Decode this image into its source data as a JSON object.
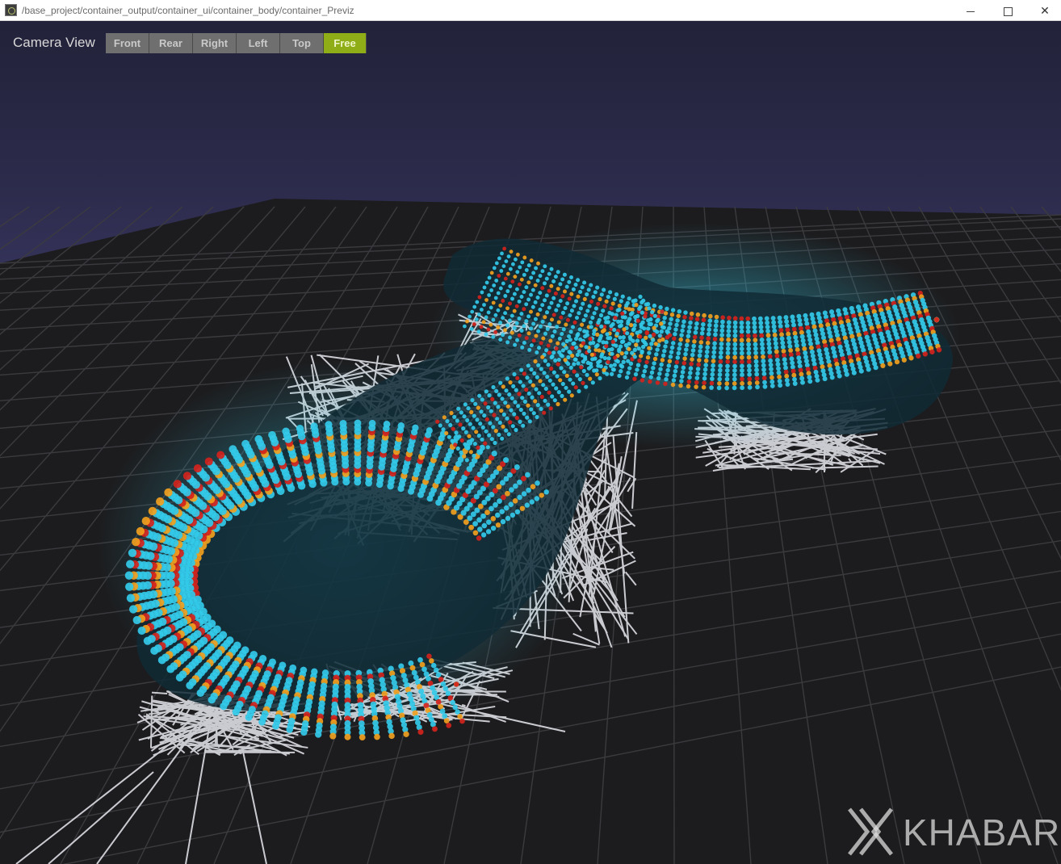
{
  "window": {
    "title": "/base_project/container_output/container_ui/container_body/container_Previz"
  },
  "viewport": {
    "camera_label": "Camera View",
    "camera_views": [
      {
        "label": "Front",
        "active": false
      },
      {
        "label": "Rear",
        "active": false
      },
      {
        "label": "Right",
        "active": false
      },
      {
        "label": "Left",
        "active": false
      },
      {
        "label": "Top",
        "active": false
      },
      {
        "label": "Free",
        "active": true
      }
    ]
  },
  "watermark": {
    "text": "KHABARI"
  },
  "colors": {
    "active_accent": "#8fad16",
    "button_gray": "#6f6f6f",
    "dot_cyan": "#33c9e8",
    "dot_orange": "#f0a020",
    "dot_red": "#d2231c",
    "wireframe": "#dcdde3"
  }
}
